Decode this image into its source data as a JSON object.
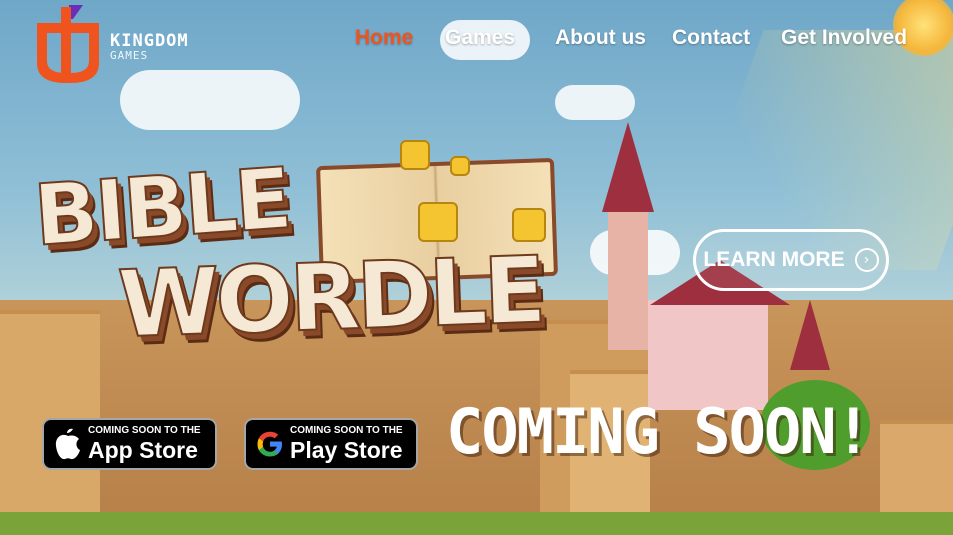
{
  "brand": {
    "name": "KINGDOM",
    "sub": "GAMES",
    "accent": "#f0541e"
  },
  "nav": {
    "items": [
      {
        "label": "Home",
        "active": true
      },
      {
        "label": "Games",
        "active": false
      },
      {
        "label": "About us",
        "active": false
      },
      {
        "label": "Contact",
        "active": false
      },
      {
        "label": "Get Involved",
        "active": false
      }
    ]
  },
  "hero": {
    "title_line1": "BIBLE",
    "title_line2": "WORDLE",
    "learn_more": "LEARN MORE",
    "coming_soon": "COMING SOON!"
  },
  "stores": {
    "apple": {
      "small": "COMING SOON TO THE",
      "big": "App Store",
      "icon": "apple-icon"
    },
    "google": {
      "small": "COMING SOON TO THE",
      "big": "Play Store",
      "icon": "google-icon"
    }
  }
}
